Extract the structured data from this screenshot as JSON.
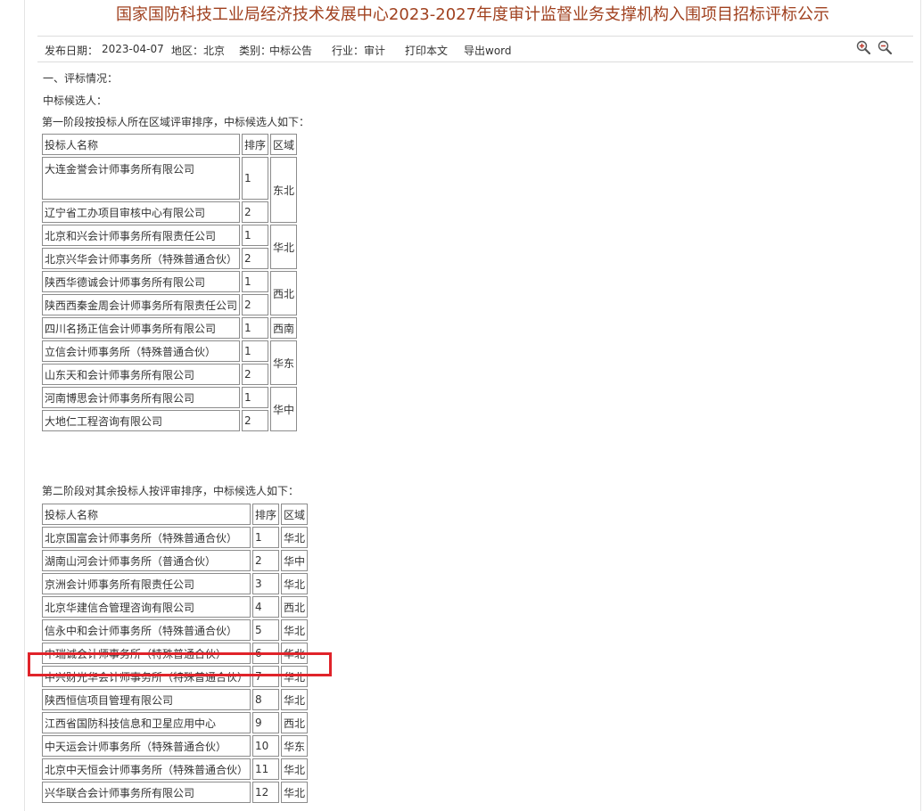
{
  "title": "国家国防科技工业局经济技术发展中心2023-2027年度审计监督业务支撑机构入围项目招标评标公示",
  "meta": {
    "publish_date_label": "发布日期：",
    "publish_date": "2023-04-07",
    "region_label": "地区：",
    "region": "北京",
    "category_label": "类别：",
    "category": "中标公告",
    "industry_label": "行业：",
    "industry": "审计",
    "print_label": "打印本文",
    "export_label": "导出word"
  },
  "icons": {
    "zoom_in": "zoom-in-icon",
    "zoom_out": "zoom-out-icon"
  },
  "section_heading": "一、评标情况：",
  "candidates_label": "中标候选人：",
  "stage1": {
    "intro": "第一阶段按投标人所在区域评审排序，中标候选人如下：",
    "headers": [
      "投标人名称",
      "排序",
      "区域"
    ],
    "rows": [
      {
        "name": "大连金誉会计师事务所有限公司",
        "rank": "1",
        "region": "东北"
      },
      {
        "name": "辽宁省工办项目审核中心有限公司",
        "rank": "2",
        "region": ""
      },
      {
        "name": "北京和兴会计师事务所有限责任公司",
        "rank": "1",
        "region": "华北"
      },
      {
        "name": "北京兴华会计师事务所（特殊普通合伙）",
        "rank": "2",
        "region": ""
      },
      {
        "name": "陕西华德诚会计师事务所有限公司",
        "rank": "1",
        "region": "西北"
      },
      {
        "name": "陕西西秦金周会计师事务所有限责任公司",
        "rank": "2",
        "region": ""
      },
      {
        "name": "四川名扬正信会计师事务所有限公司",
        "rank": "1",
        "region": "西南"
      },
      {
        "name": "立信会计师事务所（特殊普通合伙）",
        "rank": "1",
        "region": "华东"
      },
      {
        "name": "山东天和会计师事务所有限公司",
        "rank": "2",
        "region": ""
      },
      {
        "name": "河南博思会计师事务所有限公司",
        "rank": "1",
        "region": "华中"
      },
      {
        "name": "大地仁工程咨询有限公司",
        "rank": "2",
        "region": ""
      }
    ]
  },
  "stage2": {
    "intro": "第二阶段对其余投标人按评审排序，中标候选人如下：",
    "headers": [
      "投标人名称",
      "排序",
      "区域"
    ],
    "rows": [
      {
        "name": "北京国富会计师事务所（特殊普通合伙）",
        "rank": "1",
        "region": "华北"
      },
      {
        "name": "湖南山河会计师事务所（普通合伙）",
        "rank": "2",
        "region": "华中"
      },
      {
        "name": "京洲会计师事务所有限责任公司",
        "rank": "3",
        "region": "华北"
      },
      {
        "name": "北京华建信合管理咨询有限公司",
        "rank": "4",
        "region": "西北"
      },
      {
        "name": "信永中和会计师事务所（特殊普通合伙）",
        "rank": "5",
        "region": "华北"
      },
      {
        "name": "中瑞诚会计师事务所（特殊普通合伙）",
        "rank": "6",
        "region": "华北"
      },
      {
        "name": "中兴财光华会计师事务所（特殊普通合伙）",
        "rank": "7",
        "region": "华北"
      },
      {
        "name": "陕西恒信项目管理有限公司",
        "rank": "8",
        "region": "华北"
      },
      {
        "name": "江西省国防科技信息和卫星应用中心",
        "rank": "9",
        "region": "西北"
      },
      {
        "name": "中天运会计师事务所（特殊普通合伙）",
        "rank": "10",
        "region": "华东"
      },
      {
        "name": "北京中天恒会计师事务所（特殊普通合伙）",
        "rank": "11",
        "region": "华北"
      },
      {
        "name": "兴华联合会计师事务所有限公司",
        "rank": "12",
        "region": "华北"
      }
    ]
  },
  "colors": {
    "title": "#a0411f",
    "highlight": "#e0232a",
    "border": "#8c8c8c"
  }
}
